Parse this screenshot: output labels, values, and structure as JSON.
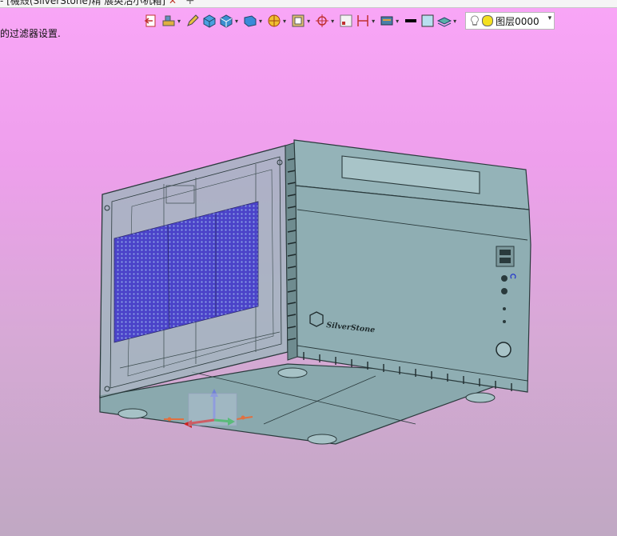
{
  "window": {
    "tab_title": "- [機殼(SilverStone)精 展英沽小机箱]",
    "tab_close": "✕",
    "new_tab": "+"
  },
  "hint_text": "的过滤器设置.",
  "toolbar": {
    "icons": [
      "exit-icon",
      "part-tools-icon",
      "pencil-icon",
      "solid-box-icon",
      "box-view-icon",
      "shaded-view-icon",
      "render-mode-icon",
      "wireframe-icon",
      "snap-icon",
      "measure-icon",
      "dimension-icon",
      "display-mode-icon",
      "line-color-icon",
      "fill-color-icon",
      "layers-icon"
    ],
    "layer_label": "图层0000",
    "dropdown_arrow": "▾"
  },
  "model": {
    "brand": "SilverStone",
    "brand_display": "SilverStone"
  },
  "colors": {
    "background_top": "#f9a6f7",
    "background_bottom": "#c0a8c3",
    "case_body": "#8fb1b7",
    "case_edge": "#2a3a3c",
    "mesh": "#4b43c9"
  }
}
